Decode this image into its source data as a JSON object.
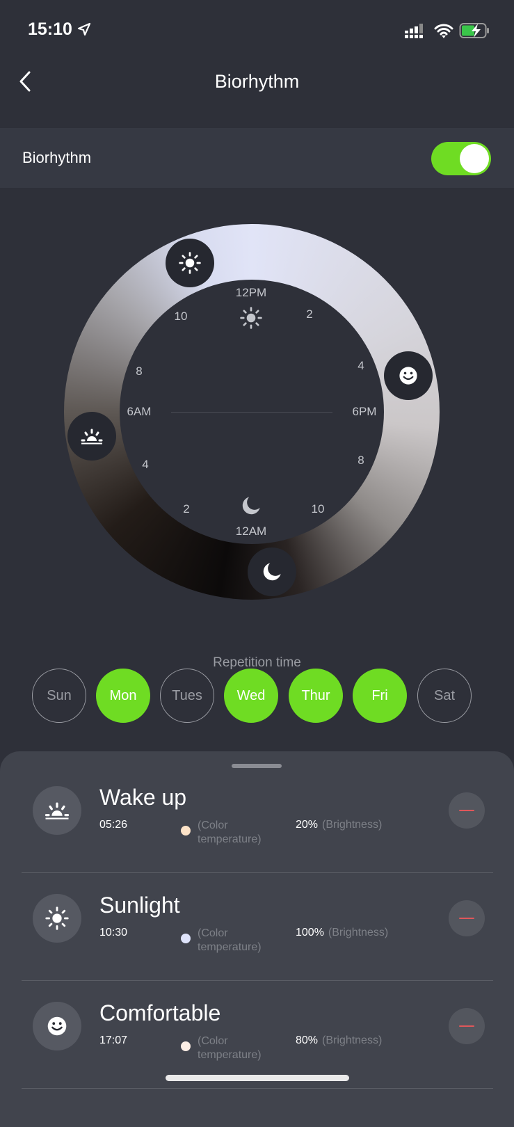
{
  "status_bar": {
    "time": "15:10",
    "icons": [
      "location-arrow-icon",
      "signal-icon",
      "wifi-icon",
      "battery-charging-icon"
    ]
  },
  "header": {
    "title": "Biorhythm",
    "back_icon": "chevron-left-icon"
  },
  "setting": {
    "label": "Biorhythm",
    "enabled": true
  },
  "dial": {
    "labels": {
      "h12pm": "12PM",
      "h2pm": "2",
      "h4pm": "4",
      "h6pm": "6PM",
      "h8pm": "8",
      "h10pm": "10",
      "h12am": "12AM",
      "h2am": "2",
      "h4am": "4",
      "h6am": "6AM",
      "h8am": "8",
      "h10am": "10"
    },
    "markers": [
      "sun-icon",
      "smile-icon",
      "sunrise-icon",
      "moon-icon"
    ]
  },
  "repetition": {
    "label": "Repetition time",
    "days": [
      {
        "label": "Sun",
        "selected": false
      },
      {
        "label": "Mon",
        "selected": true
      },
      {
        "label": "Tues",
        "selected": false
      },
      {
        "label": "Wed",
        "selected": true
      },
      {
        "label": "Thur",
        "selected": true
      },
      {
        "label": "Fri",
        "selected": true
      },
      {
        "label": "Sat",
        "selected": false
      }
    ]
  },
  "colors": {
    "accent": "#6fdc23",
    "remove": "#e0575a"
  },
  "schedule": [
    {
      "title": "Wake up",
      "time": "05:26",
      "color": "#fde3c8",
      "color_label": "(Color temperature)",
      "brightness": "20%",
      "brightness_label": "(Brightness)",
      "icon": "sunrise-icon"
    },
    {
      "title": "Sunlight",
      "time": "10:30",
      "color": "#dfe4fb",
      "color_label": "(Color temperature)",
      "brightness": "100%",
      "brightness_label": "(Brightness)",
      "icon": "sun-icon"
    },
    {
      "title": "Comfortable",
      "time": "17:07",
      "color": "#fdefe6",
      "color_label": "(Color temperature)",
      "brightness": "80%",
      "brightness_label": "(Brightness)",
      "icon": "smile-icon"
    }
  ]
}
